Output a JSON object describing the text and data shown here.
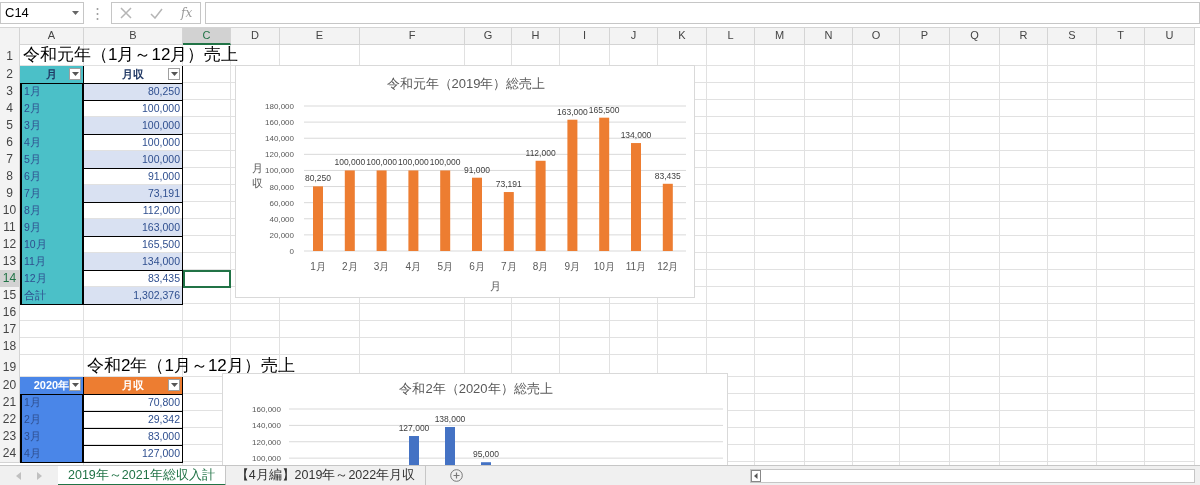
{
  "name_box": {
    "text": "C14"
  },
  "formula_bar": {
    "function_label": "fx"
  },
  "columns": [
    {
      "label": "A",
      "selected": false
    },
    {
      "label": "B",
      "selected": false
    },
    {
      "label": "C",
      "selected": true
    },
    {
      "label": "D",
      "selected": false
    },
    {
      "label": "E",
      "selected": false
    },
    {
      "label": "F",
      "selected": false
    },
    {
      "label": "G",
      "selected": false
    },
    {
      "label": "H",
      "selected": false
    },
    {
      "label": "I",
      "selected": false
    },
    {
      "label": "J",
      "selected": false
    },
    {
      "label": "K",
      "selected": false
    },
    {
      "label": "L",
      "selected": false
    },
    {
      "label": "M",
      "selected": false
    },
    {
      "label": "N",
      "selected": false
    },
    {
      "label": "O",
      "selected": false
    },
    {
      "label": "P",
      "selected": false
    },
    {
      "label": "Q",
      "selected": false
    },
    {
      "label": "R",
      "selected": false
    },
    {
      "label": "S",
      "selected": false
    },
    {
      "label": "T",
      "selected": false
    },
    {
      "label": "U",
      "selected": false
    }
  ],
  "rows": [
    {
      "number": "1",
      "selected": false,
      "cells": [
        {
          "kind": "title",
          "text": "令和元年（1月～12月）売上"
        }
      ]
    },
    {
      "number": "2",
      "selected": false,
      "cells": [
        {
          "kind": "head",
          "text": "月",
          "color": "#4bc0c8",
          "filter": true
        },
        {
          "kind": "head",
          "text": "月収",
          "color": "#ffffff",
          "filter": true
        }
      ]
    },
    {
      "number": "3",
      "selected": false,
      "cells": [
        {
          "kind": "label",
          "text": "1月",
          "color": "#4bc0c8"
        },
        {
          "kind": "amount",
          "text": "80,250",
          "banded": true
        }
      ]
    },
    {
      "number": "4",
      "selected": false,
      "cells": [
        {
          "kind": "label",
          "text": "2月",
          "color": "#4bc0c8"
        },
        {
          "kind": "amount",
          "text": "100,000",
          "banded": false
        }
      ]
    },
    {
      "number": "5",
      "selected": false,
      "cells": [
        {
          "kind": "label",
          "text": "3月",
          "color": "#4bc0c8"
        },
        {
          "kind": "amount",
          "text": "100,000",
          "banded": true
        }
      ]
    },
    {
      "number": "6",
      "selected": false,
      "cells": [
        {
          "kind": "label",
          "text": "4月",
          "color": "#4bc0c8"
        },
        {
          "kind": "amount",
          "text": "100,000",
          "banded": false
        }
      ]
    },
    {
      "number": "7",
      "selected": false,
      "cells": [
        {
          "kind": "label",
          "text": "5月",
          "color": "#4bc0c8"
        },
        {
          "kind": "amount",
          "text": "100,000",
          "banded": true
        }
      ]
    },
    {
      "number": "8",
      "selected": false,
      "cells": [
        {
          "kind": "label",
          "text": "6月",
          "color": "#4bc0c8"
        },
        {
          "kind": "amount",
          "text": "91,000",
          "banded": false
        }
      ]
    },
    {
      "number": "9",
      "selected": false,
      "cells": [
        {
          "kind": "label",
          "text": "7月",
          "color": "#4bc0c8"
        },
        {
          "kind": "amount",
          "text": "73,191",
          "banded": true
        }
      ]
    },
    {
      "number": "10",
      "selected": false,
      "cells": [
        {
          "kind": "label",
          "text": "8月",
          "color": "#4bc0c8"
        },
        {
          "kind": "amount",
          "text": "112,000",
          "banded": false
        }
      ]
    },
    {
      "number": "11",
      "selected": false,
      "cells": [
        {
          "kind": "label",
          "text": "9月",
          "color": "#4bc0c8"
        },
        {
          "kind": "amount",
          "text": "163,000",
          "banded": true
        }
      ]
    },
    {
      "number": "12",
      "selected": false,
      "cells": [
        {
          "kind": "label",
          "text": "10月",
          "color": "#4bc0c8"
        },
        {
          "kind": "amount",
          "text": "165,500",
          "banded": false
        }
      ]
    },
    {
      "number": "13",
      "selected": false,
      "cells": [
        {
          "kind": "label",
          "text": "11月",
          "color": "#4bc0c8"
        },
        {
          "kind": "amount",
          "text": "134,000",
          "banded": true
        }
      ]
    },
    {
      "number": "14",
      "selected": true,
      "cells": [
        {
          "kind": "label",
          "text": "12月",
          "color": "#4bc0c8"
        },
        {
          "kind": "amount",
          "text": "83,435",
          "banded": false
        }
      ]
    },
    {
      "number": "15",
      "selected": false,
      "cells": [
        {
          "kind": "label",
          "text": "合計",
          "color": "#4bc0c8"
        },
        {
          "kind": "amount",
          "text": "1,302,376",
          "banded": true
        }
      ]
    },
    {
      "number": "16",
      "selected": false,
      "cells": []
    },
    {
      "number": "17",
      "selected": false,
      "cells": []
    },
    {
      "number": "18",
      "selected": false,
      "cells": []
    },
    {
      "number": "19",
      "selected": false,
      "cells": [
        {
          "kind": "blank"
        },
        {
          "kind": "title",
          "text": "令和2年（1月～12月）売上"
        }
      ]
    },
    {
      "number": "20",
      "selected": false,
      "cells": [
        {
          "kind": "head",
          "text": "2020年",
          "color": "#4a86e8",
          "filter": true
        },
        {
          "kind": "head",
          "text": "月収",
          "color": "#ed7d31",
          "filter": true
        }
      ]
    },
    {
      "number": "21",
      "selected": false,
      "cells": [
        {
          "kind": "label",
          "text": "1月",
          "color": "#4a86e8"
        },
        {
          "kind": "amount",
          "text": "70,800",
          "banded": false
        }
      ]
    },
    {
      "number": "22",
      "selected": false,
      "cells": [
        {
          "kind": "label",
          "text": "2月",
          "color": "#4a86e8"
        },
        {
          "kind": "amount",
          "text": "29,342",
          "banded": false
        }
      ]
    },
    {
      "number": "23",
      "selected": false,
      "cells": [
        {
          "kind": "label",
          "text": "3月",
          "color": "#4a86e8"
        },
        {
          "kind": "amount",
          "text": "83,000",
          "banded": false
        }
      ]
    },
    {
      "number": "24",
      "selected": false,
      "cells": [
        {
          "kind": "label",
          "text": "4月",
          "color": "#4a86e8"
        },
        {
          "kind": "amount",
          "text": "127,000",
          "banded": false
        }
      ]
    }
  ],
  "charts": [
    {
      "chart_data": {
        "type": "bar",
        "title": "令和元年（2019年）総売上",
        "xlabel": "月",
        "ylabel": "月収",
        "categories": [
          "1月",
          "2月",
          "3月",
          "4月",
          "5月",
          "6月",
          "7月",
          "8月",
          "9月",
          "10月",
          "11月",
          "12月"
        ],
        "series": [
          {
            "color": "#ed7d31",
            "values": [
              80250,
              100000,
              100000,
              100000,
              100000,
              91000,
              73191,
              112000,
              163000,
              165500,
              134000,
              83435
            ]
          }
        ],
        "ylim": [
          0,
          180000
        ],
        "grid": true,
        "yticks": [
          {
            "value": 0,
            "label": "0"
          },
          {
            "value": 20000,
            "label": "20,000"
          },
          {
            "value": 40000,
            "label": "40,000"
          },
          {
            "value": 60000,
            "label": "60,000"
          },
          {
            "value": 80000,
            "label": "80,000"
          },
          {
            "value": 100000,
            "label": "100,000"
          },
          {
            "value": 120000,
            "label": "120,000"
          },
          {
            "value": 140000,
            "label": "140,000"
          },
          {
            "value": 160000,
            "label": "160,000"
          },
          {
            "value": 180000,
            "label": "180,000"
          }
        ],
        "value_labels": [
          "80,250",
          "100,000",
          "100,000",
          "100,000",
          "100,000",
          "91,000",
          "73,191",
          "112,000",
          "163,000",
          "165,500",
          "134,000",
          "83,435"
        ]
      }
    },
    {
      "chart_data": {
        "type": "bar",
        "title": "令和2年（2020年）総売上",
        "series": [
          {
            "color": "#4472c4",
            "values": [
              null,
              null,
              null,
              127000,
              138000,
              95000,
              null,
              null,
              null,
              null,
              null,
              null
            ]
          }
        ],
        "ylim": [
          0,
          160000
        ],
        "grid": true,
        "yticks": [
          {
            "value": 100000,
            "label": "100,000"
          },
          {
            "value": 120000,
            "label": "120,000"
          },
          {
            "value": 140000,
            "label": "140,000"
          },
          {
            "value": 160000,
            "label": "160,000"
          }
        ],
        "value_labels": [
          null,
          null,
          null,
          "127,000",
          "138,000",
          "95,000",
          null,
          null,
          null,
          null,
          null,
          null
        ]
      }
    }
  ],
  "sheet_tabs": [
    {
      "label": "2019年～2021年総収入計",
      "selected": true
    },
    {
      "label": "【4月編】2019年～2022年月収",
      "selected": false
    }
  ]
}
